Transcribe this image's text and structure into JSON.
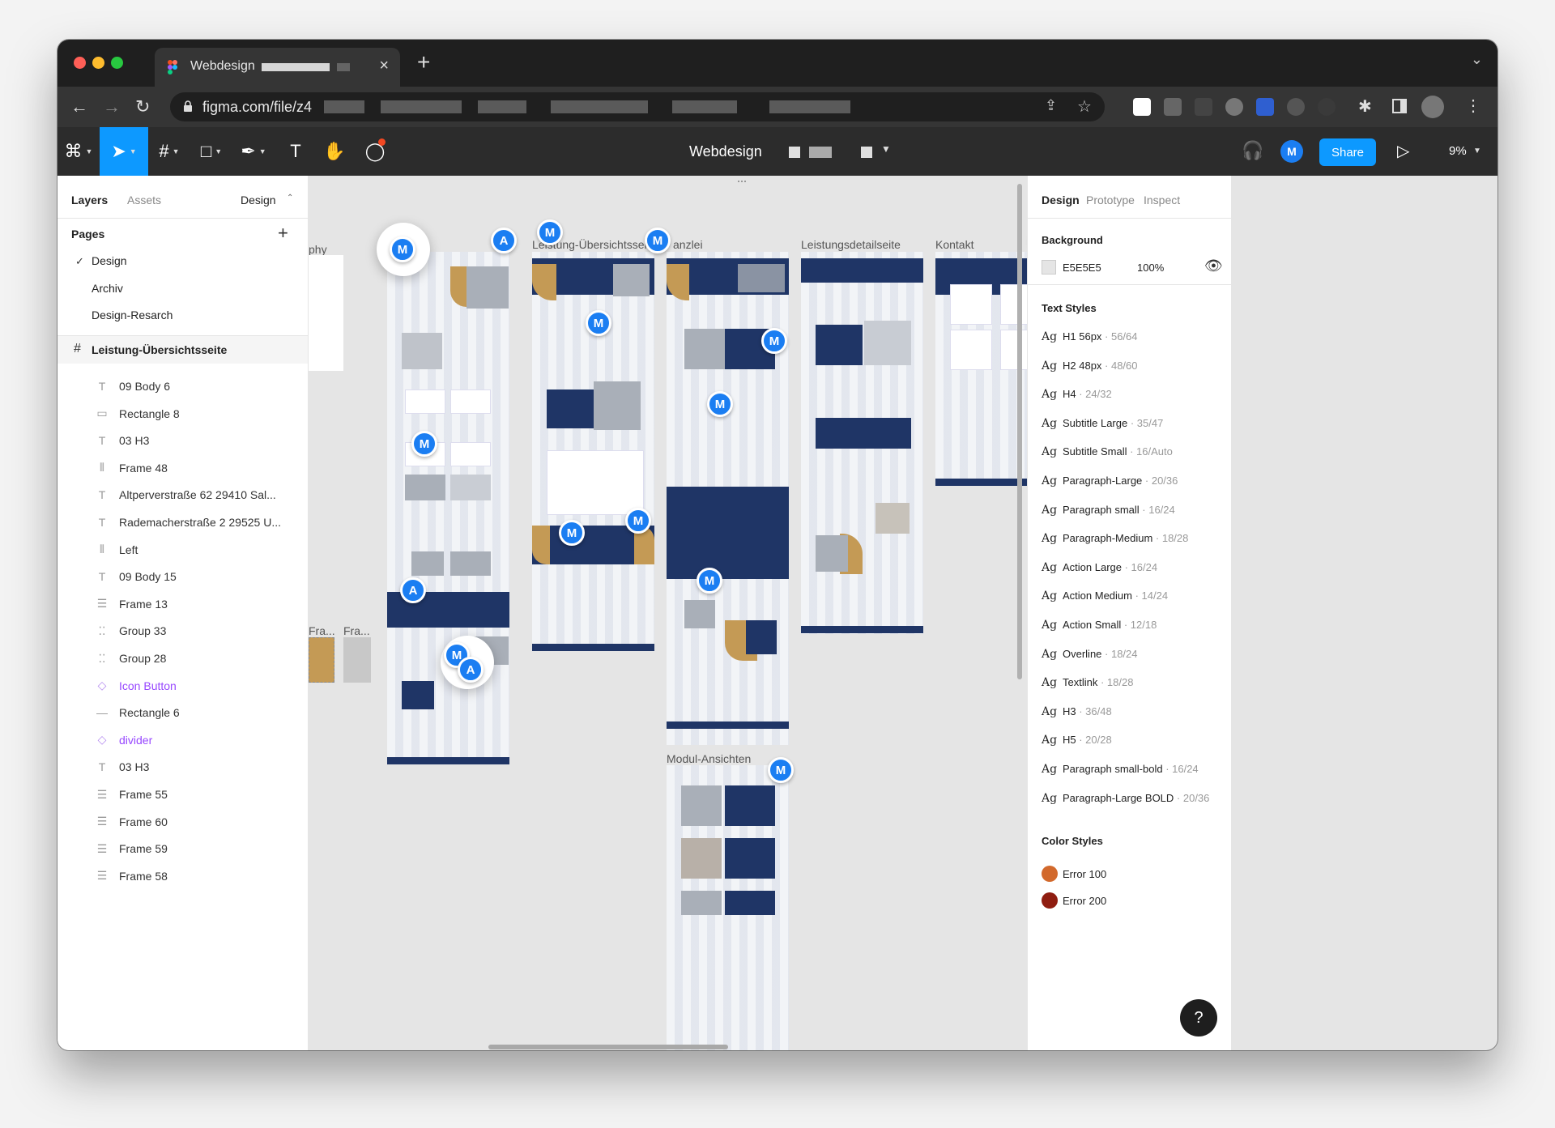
{
  "browser": {
    "tab_title": "Webdesign",
    "url": "figma.com/file/z4"
  },
  "toolbar": {
    "file_name": "Webdesign",
    "share_label": "Share",
    "zoom": "9%",
    "user_initial": "M"
  },
  "left_panel": {
    "tabs": [
      "Layers",
      "Assets"
    ],
    "page_dropdown": "Design",
    "pages_title": "Pages",
    "pages": [
      "Design",
      "Archiv",
      "Design-Resarch"
    ],
    "current_page": "Design",
    "selected_frame": "Leistung-Übersichtsseite",
    "layers": [
      {
        "name": "09 Body 6",
        "icon": "text"
      },
      {
        "name": "Rectangle 8",
        "icon": "rectangle"
      },
      {
        "name": "03 H3",
        "icon": "text"
      },
      {
        "name": "Frame 48",
        "icon": "frame-columns"
      },
      {
        "name": "Altperverstraße 62 29410 Sal...",
        "icon": "text"
      },
      {
        "name": "Rademacherstraße 2 29525 U...",
        "icon": "text"
      },
      {
        "name": "Left",
        "icon": "frame-columns"
      },
      {
        "name": "09 Body 15",
        "icon": "text"
      },
      {
        "name": "Frame 13",
        "icon": "frame-rows"
      },
      {
        "name": "Group 33",
        "icon": "group"
      },
      {
        "name": "Group 28",
        "icon": "group"
      },
      {
        "name": "Icon Button",
        "icon": "component"
      },
      {
        "name": "Rectangle 6",
        "icon": "line"
      },
      {
        "name": "divider",
        "icon": "component"
      },
      {
        "name": "03 H3",
        "icon": "text"
      },
      {
        "name": "Frame 55",
        "icon": "frame-rows"
      },
      {
        "name": "Frame 60",
        "icon": "frame-rows"
      },
      {
        "name": "Frame 59",
        "icon": "frame-rows"
      },
      {
        "name": "Frame 58",
        "icon": "frame-rows"
      }
    ]
  },
  "right_panel": {
    "tabs": [
      "Design",
      "Prototype",
      "Inspect"
    ],
    "background_title": "Background",
    "background_color": "E5E5E5",
    "background_opacity": "100%",
    "text_styles_title": "Text Styles",
    "text_styles": [
      {
        "name": "H1 56px",
        "meta": " · 56/64"
      },
      {
        "name": "H2 48px",
        "meta": " · 48/60"
      },
      {
        "name": "H4",
        "meta": " · 24/32"
      },
      {
        "name": "Subtitle Large",
        "meta": " · 35/47"
      },
      {
        "name": "Subtitle Small",
        "meta": " · 16/Auto"
      },
      {
        "name": "Paragraph-Large",
        "meta": " · 20/36"
      },
      {
        "name": "Paragraph small",
        "meta": " · 16/24"
      },
      {
        "name": "Paragraph-Medium",
        "meta": " · 18/28"
      },
      {
        "name": "Action Large",
        "meta": " · 16/24"
      },
      {
        "name": "Action Medium",
        "meta": " · 14/24"
      },
      {
        "name": "Action Small",
        "meta": " · 12/18"
      },
      {
        "name": "Overline",
        "meta": " · 18/24"
      },
      {
        "name": "Textlink",
        "meta": " · 18/28"
      },
      {
        "name": "H3",
        "meta": " · 36/48"
      },
      {
        "name": "H5",
        "meta": " · 20/28"
      },
      {
        "name": "Paragraph small-bold",
        "meta": " · 16/24"
      },
      {
        "name": "Paragraph-Large BOLD",
        "meta": " · 20/36"
      }
    ],
    "text_style_glyph": "Ag",
    "color_styles_title": "Color Styles",
    "color_styles": [
      {
        "name": "Error 100",
        "color": "#d2692c"
      },
      {
        "name": "Error 200",
        "color": "#8f1d10"
      }
    ],
    "help": "?"
  },
  "canvas": {
    "frame_labels": {
      "typography": "phy",
      "overview": "Leistung-Übersichtsseite",
      "kanzlei": "anzlei",
      "detail": "Leistungsdetailseite",
      "kontakt": "Kontakt",
      "modules": "Modul-Ansichten",
      "fra1": "Fra...",
      "fra2": "Fra..."
    },
    "cursors": [
      "M",
      "A"
    ]
  },
  "colors": {
    "figma_blue": "#0d99ff",
    "navy": "#1f3566",
    "gold": "#c49a55",
    "cursor_blue": "#1b7ef2"
  }
}
